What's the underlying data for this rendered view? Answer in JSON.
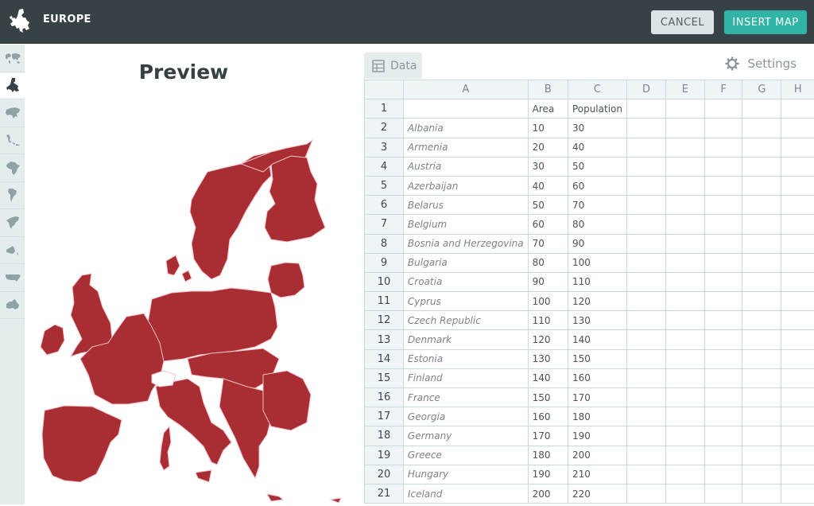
{
  "header": {
    "title": "EUROPE",
    "cancel_label": "CANCEL",
    "insert_label": "INSERT MAP"
  },
  "sidebar": {
    "items": [
      {
        "name": "world",
        "icon": "world-map-icon",
        "active": false
      },
      {
        "name": "europe",
        "icon": "europe-map-icon",
        "active": true
      },
      {
        "name": "asia",
        "icon": "asia-map-icon",
        "active": false
      },
      {
        "name": "southeast-asia",
        "icon": "southeast-asia-map-icon",
        "active": false
      },
      {
        "name": "africa",
        "icon": "africa-map-icon",
        "active": false
      },
      {
        "name": "south-america",
        "icon": "south-america-map-icon",
        "active": false
      },
      {
        "name": "north-america",
        "icon": "north-america-map-icon",
        "active": false
      },
      {
        "name": "oceania",
        "icon": "oceania-map-icon",
        "active": false
      },
      {
        "name": "usa",
        "icon": "usa-map-icon",
        "active": false
      },
      {
        "name": "australia",
        "icon": "australia-map-icon",
        "active": false
      }
    ]
  },
  "preview": {
    "title": "Preview",
    "fill_color": "#a92e33",
    "border_color": "#f4c2c8"
  },
  "data_panel": {
    "tab_label": "Data",
    "settings_label": "Settings",
    "columns": [
      "",
      "A",
      "B",
      "C",
      "D",
      "E",
      "F",
      "G",
      "H"
    ],
    "rows": [
      [
        "1",
        "",
        "Area",
        "Population"
      ],
      [
        "2",
        "Albania",
        "10",
        "30"
      ],
      [
        "3",
        "Armenia",
        "20",
        "40"
      ],
      [
        "4",
        "Austria",
        "30",
        "50"
      ],
      [
        "5",
        "Azerbaijan",
        "40",
        "60"
      ],
      [
        "6",
        "Belarus",
        "50",
        "70"
      ],
      [
        "7",
        "Belgium",
        "60",
        "80"
      ],
      [
        "8",
        "Bosnia and Herzegovina",
        "70",
        "90"
      ],
      [
        "9",
        "Bulgaria",
        "80",
        "100"
      ],
      [
        "10",
        "Croatia",
        "90",
        "110"
      ],
      [
        "11",
        "Cyprus",
        "100",
        "120"
      ],
      [
        "12",
        "Czech Republic",
        "110",
        "130"
      ],
      [
        "13",
        "Denmark",
        "120",
        "140"
      ],
      [
        "14",
        "Estonia",
        "130",
        "150"
      ],
      [
        "15",
        "Finland",
        "140",
        "160"
      ],
      [
        "16",
        "France",
        "150",
        "170"
      ],
      [
        "17",
        "Georgia",
        "160",
        "180"
      ],
      [
        "18",
        "Germany",
        "170",
        "190"
      ],
      [
        "19",
        "Greece",
        "180",
        "200"
      ],
      [
        "20",
        "Hungary",
        "190",
        "210"
      ],
      [
        "21",
        "Iceland",
        "200",
        "220"
      ]
    ]
  }
}
